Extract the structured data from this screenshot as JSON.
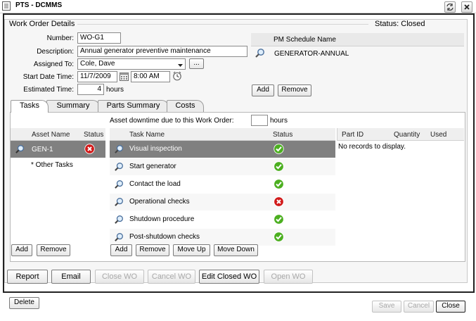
{
  "window": {
    "title": "PTS - DCMMS"
  },
  "header": {
    "section_title": "Work Order Details",
    "status": "Status: Closed"
  },
  "form": {
    "number_label": "Number:",
    "number_value": "WO-G1",
    "description_label": "Description:",
    "description_value": "Annual generator preventive maintenance",
    "assigned_label": "Assigned To:",
    "assigned_value": "Cole, Dave",
    "assigned_button": "...",
    "start_label": "Start Date Time:",
    "start_date": "11/7/2009",
    "start_time": "8:00 AM",
    "estimated_label": "Estimated Time:",
    "estimated_value": "4",
    "estimated_unit": "hours"
  },
  "pm": {
    "header": "PM Schedule Name",
    "item": "GENERATOR-ANNUAL",
    "add": "Add",
    "remove": "Remove"
  },
  "tabs": [
    {
      "label": "Tasks"
    },
    {
      "label": "Summary"
    },
    {
      "label": "Parts Summary"
    },
    {
      "label": "Costs"
    }
  ],
  "downtime": {
    "label": "Asset downtime due to this Work Order:",
    "value": "",
    "unit": "hours"
  },
  "assets": {
    "col_name": "Asset Name",
    "col_status": "Status",
    "rows": [
      {
        "name": "GEN-1",
        "status": "incomplete"
      }
    ],
    "other": "* Other Tasks",
    "add": "Add",
    "remove": "Remove"
  },
  "tasks": {
    "col_name": "Task Name",
    "col_status": "Status",
    "rows": [
      {
        "name": "Visual inspection",
        "status": "complete"
      },
      {
        "name": "Start generator",
        "status": "complete"
      },
      {
        "name": "Contact the load",
        "status": "complete"
      },
      {
        "name": "Operational checks",
        "status": "incomplete"
      },
      {
        "name": "Shutdown procedure",
        "status": "complete"
      },
      {
        "name": "Post-shutdown checks",
        "status": "complete"
      }
    ],
    "add": "Add",
    "remove": "Remove",
    "move_up": "Move Up",
    "move_down": "Move Down"
  },
  "parts": {
    "col_id": "Part ID",
    "col_qty": "Quantity",
    "col_used": "Used",
    "empty": "No records to display."
  },
  "actions": {
    "report": "Report",
    "email": "Email",
    "close_wo": "Close WO",
    "cancel_wo": "Cancel WO",
    "edit_closed": "Edit Closed WO",
    "open_wo": "Open WO"
  },
  "footer": {
    "delete": "Delete",
    "save": "Save",
    "cancel": "Cancel",
    "close": "Close"
  },
  "colors": {
    "selected_row": "#808080",
    "ok_green": "#4caf20",
    "bad_red": "#d11a1a"
  }
}
